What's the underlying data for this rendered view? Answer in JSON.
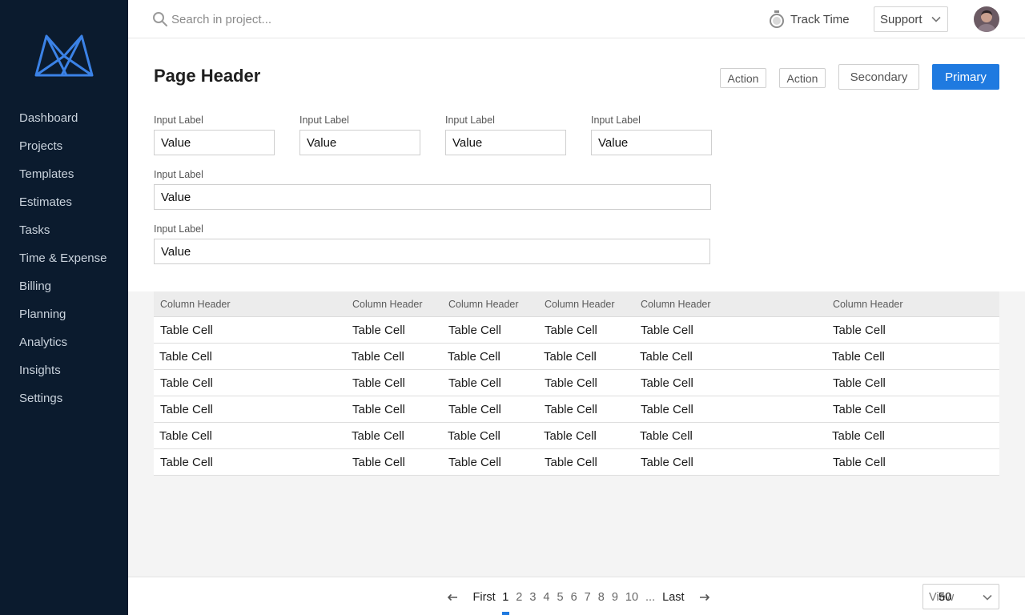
{
  "nav": {
    "items": [
      "Dashboard",
      "Projects",
      "Templates",
      "Estimates",
      "Tasks",
      "Time & Expense",
      "Billing",
      "Planning",
      "Analytics",
      "Insights",
      "Settings"
    ]
  },
  "topbar": {
    "search_placeholder": "Search in project...",
    "track_time": "Track Time",
    "support": "Support"
  },
  "page": {
    "title": "Page Header",
    "actions": [
      "Action",
      "Action"
    ],
    "secondary": "Secondary",
    "primary": "Primary"
  },
  "form": {
    "fields": [
      {
        "label": "Input Label",
        "value": "Value"
      },
      {
        "label": "Input Label",
        "value": "Value"
      },
      {
        "label": "Input Label",
        "value": "Value"
      },
      {
        "label": "Input Label",
        "value": "Value"
      },
      {
        "label": "Input Label",
        "value": "Value"
      },
      {
        "label": "Input Label",
        "value": "Value"
      }
    ]
  },
  "table": {
    "headers": [
      "Column Header",
      "Column Header",
      "Column Header",
      "Column Header",
      "Column Header",
      "Column Header"
    ],
    "rows": [
      [
        "Table Cell",
        "Table Cell",
        "Table Cell",
        "Table Cell",
        "Table Cell",
        "Table Cell"
      ],
      [
        "Table Cell",
        "Table Cell",
        "Table Cell",
        "Table Cell",
        "Table Cell",
        "Table Cell"
      ],
      [
        "Table Cell",
        "Table Cell",
        "Table Cell",
        "Table Cell",
        "Table Cell",
        "Table Cell"
      ],
      [
        "Table Cell",
        "Table Cell",
        "Table Cell",
        "Table Cell",
        "Table Cell",
        "Table Cell"
      ],
      [
        "Table Cell",
        "Table Cell",
        "Table Cell",
        "Table Cell",
        "Table Cell",
        "Table Cell"
      ],
      [
        "Table Cell",
        "Table Cell",
        "Table Cell",
        "Table Cell",
        "Table Cell",
        "Table Cell"
      ]
    ]
  },
  "pagination": {
    "first": "First",
    "pages": [
      "1",
      "2",
      "3",
      "4",
      "5",
      "6",
      "7",
      "8",
      "9",
      "10"
    ],
    "current": "1",
    "ellipsis": "...",
    "last": "Last",
    "view_label": "View",
    "view_value": "50"
  },
  "colors": {
    "sidebar_bg": "#0b1b2e",
    "primary": "#1f7ae0",
    "logo": "#3b82e6"
  },
  "icons": {
    "logo": "brand-logo",
    "search": "search-icon",
    "track_time": "stopwatch-icon",
    "support_dropdown": "chevron-down-icon",
    "prev": "arrow-left-icon",
    "next": "arrow-right-icon"
  }
}
